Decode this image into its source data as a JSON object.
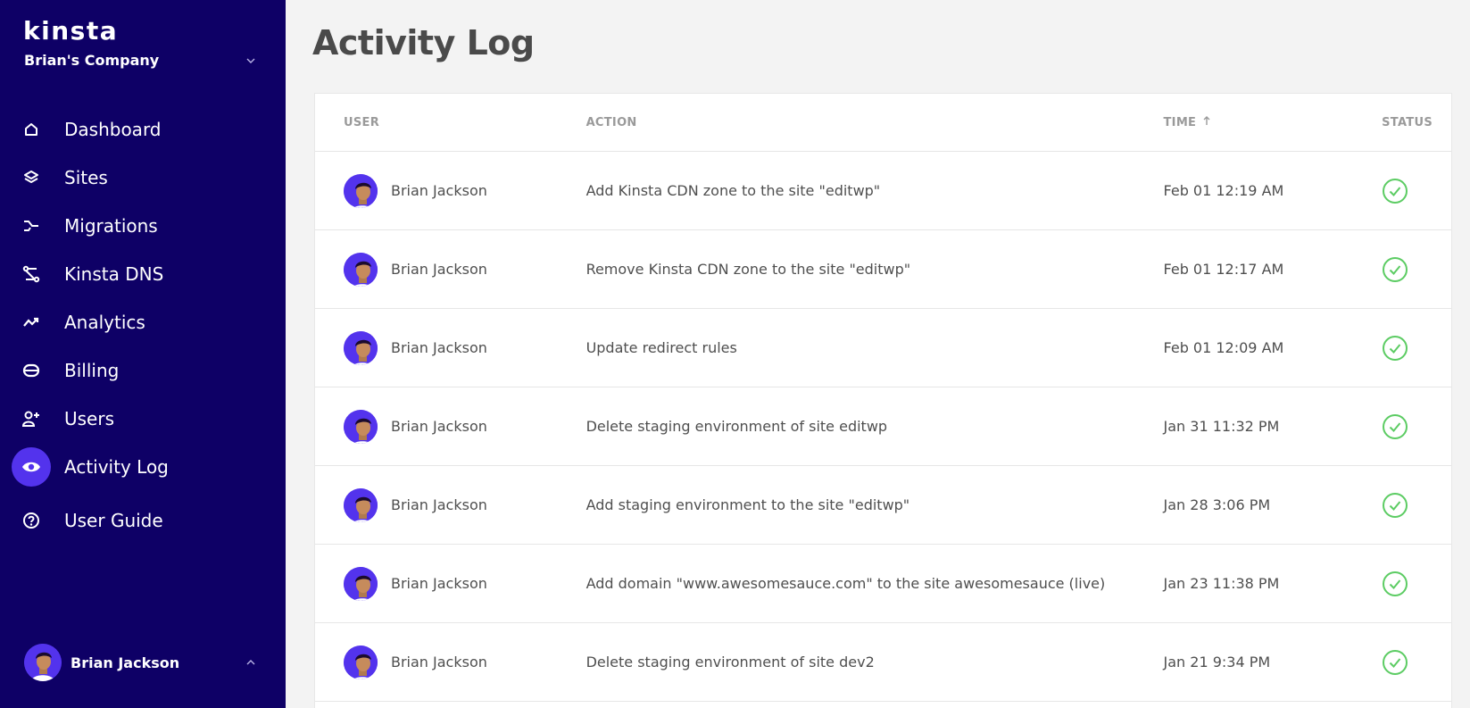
{
  "sidebar": {
    "logo": "kinsta",
    "company": "Brian's Company",
    "items": [
      {
        "label": "Dashboard",
        "icon": "home-icon"
      },
      {
        "label": "Sites",
        "icon": "layers-icon"
      },
      {
        "label": "Migrations",
        "icon": "migrations-icon"
      },
      {
        "label": "Kinsta DNS",
        "icon": "dns-icon"
      },
      {
        "label": "Analytics",
        "icon": "trend-icon"
      },
      {
        "label": "Billing",
        "icon": "billing-icon"
      },
      {
        "label": "Users",
        "icon": "add-user-icon"
      },
      {
        "label": "Activity Log",
        "icon": "eye-icon",
        "active": true
      },
      {
        "label": "User Guide",
        "icon": "help-icon"
      }
    ],
    "user": "Brian Jackson"
  },
  "main": {
    "title": "Activity Log",
    "columns": {
      "user": "USER",
      "action": "ACTION",
      "time": "TIME",
      "status": "STATUS"
    },
    "rows": [
      {
        "user": "Brian Jackson",
        "action": "Add Kinsta CDN zone to the site \"editwp\"",
        "time": "Feb 01 12:19 AM",
        "status": "success"
      },
      {
        "user": "Brian Jackson",
        "action": "Remove Kinsta CDN zone to the site \"editwp\"",
        "time": "Feb 01 12:17 AM",
        "status": "success"
      },
      {
        "user": "Brian Jackson",
        "action": "Update redirect rules",
        "time": "Feb 01 12:09 AM",
        "status": "success"
      },
      {
        "user": "Brian Jackson",
        "action": "Delete staging environment of site editwp",
        "time": "Jan 31 11:32 PM",
        "status": "success"
      },
      {
        "user": "Brian Jackson",
        "action": "Add staging environment to the site \"editwp\"",
        "time": "Jan 28 3:06 PM",
        "status": "success"
      },
      {
        "user": "Brian Jackson",
        "action": "Add domain \"www.awesomesauce.com\" to the site awesomesauce (live)",
        "time": "Jan 23 11:38 PM",
        "status": "success"
      },
      {
        "user": "Brian Jackson",
        "action": "Delete staging environment of site dev2",
        "time": "Jan 21 9:34 PM",
        "status": "success"
      }
    ]
  },
  "colors": {
    "sidebar_bg": "#0e0066",
    "accent": "#5333ed",
    "success": "#5ccc63"
  }
}
